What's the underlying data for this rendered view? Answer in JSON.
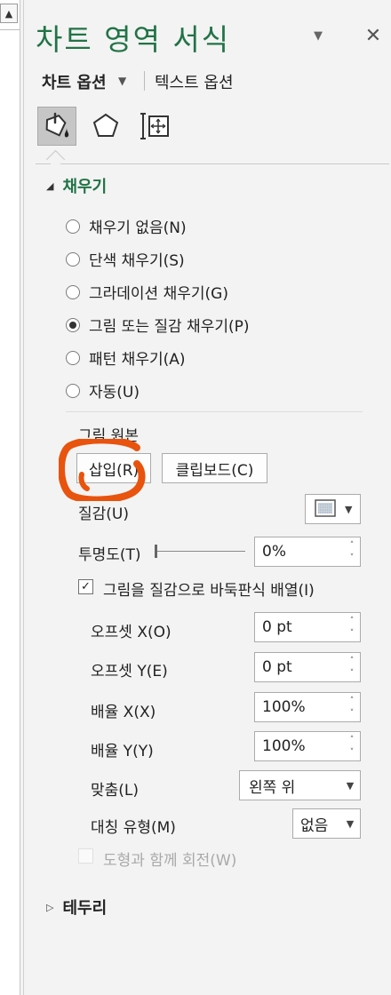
{
  "pane": {
    "title": "차트 영역 서식",
    "menu_icon": "chevron-down-icon",
    "close_icon": "close-icon"
  },
  "tabs": {
    "chart_options": "차트 옵션",
    "text_options": "텍스트 옵션"
  },
  "category_icons": [
    "paint-bucket-icon",
    "pentagon-icon",
    "size-properties-icon"
  ],
  "fill": {
    "section_title": "채우기",
    "options": [
      {
        "label": "채우기 없음(N)",
        "selected": false
      },
      {
        "label": "단색 채우기(S)",
        "selected": false
      },
      {
        "label": "그라데이션 채우기(G)",
        "selected": false
      },
      {
        "label": "그림 또는 질감 채우기(P)",
        "selected": true
      },
      {
        "label": "패턴 채우기(A)",
        "selected": false
      },
      {
        "label": "자동(U)",
        "selected": false
      }
    ],
    "picture_source_label": "그림 원본",
    "insert_button": "삽입(R)",
    "clipboard_button": "클립보드(C)",
    "texture_label": "질감(U)",
    "transparency_label": "투명도(T)",
    "transparency_value": "0%",
    "transparency_level": 0,
    "tile_checkbox_label": "그림을 질감으로 바둑판식 배열(I)",
    "tile_checked": true,
    "offset_x_label": "오프셋 X(O)",
    "offset_x_value": "0 pt",
    "offset_y_label": "오프셋 Y(E)",
    "offset_y_value": "0 pt",
    "scale_x_label": "배율 X(X)",
    "scale_x_value": "100%",
    "scale_y_label": "배율 Y(Y)",
    "scale_y_value": "100%",
    "alignment_label": "맞춤(L)",
    "alignment_value": "왼쪽 위",
    "mirror_label": "대칭 유형(M)",
    "mirror_value": "없음",
    "rotate_label": "도형과 함께 회전(W)",
    "rotate_checked": false
  },
  "border": {
    "section_title": "테두리"
  },
  "colors": {
    "accent": "#217346",
    "annotation": "#e8530e"
  }
}
